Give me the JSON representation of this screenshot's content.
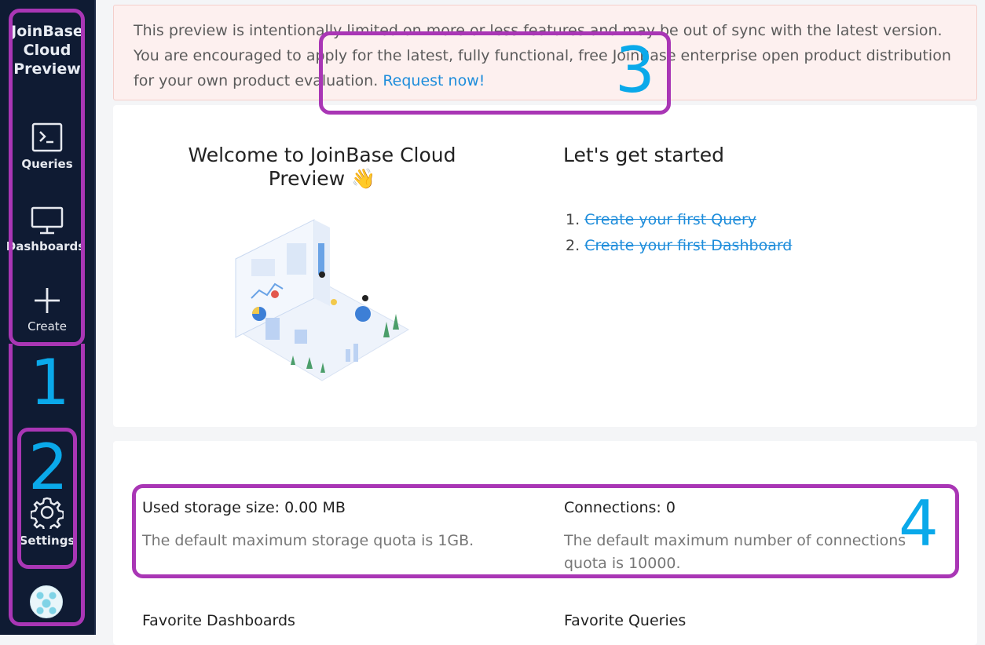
{
  "sidebar": {
    "logo_lines": [
      "JoinBase",
      "Cloud",
      "Preview"
    ],
    "items": [
      {
        "label": "Queries",
        "icon": "terminal-icon"
      },
      {
        "label": "Dashboards",
        "icon": "monitor-icon"
      },
      {
        "label": "Create",
        "icon": "plus-icon"
      },
      {
        "label": "Settings",
        "icon": "gear-icon"
      }
    ],
    "avatar": "user-avatar"
  },
  "alert": {
    "text": "This preview is intentionally limited on more or less features and may be out of sync with the latest version. You are encouraged to apply for the latest, fully functional, free JoinBase enterprise open product distribution for your own product evaluation. ",
    "link": "Request now!"
  },
  "welcome": {
    "title": "Welcome to JoinBase Cloud Preview 👋",
    "started_title": "Let's get started",
    "steps": [
      {
        "num": "1.",
        "label": "Create your first Query"
      },
      {
        "num": "2.",
        "label": "Create your first Dashboard"
      }
    ]
  },
  "stats": {
    "storage_label": "Used storage size: 0.00 MB",
    "storage_note": "The default maximum storage quota is 1GB.",
    "connections_label": "Connections: 0",
    "connections_note": "The default maximum number of connections quota is 10000.",
    "favorite_dashboards": "Favorite Dashboards",
    "favorite_queries": "Favorite Queries"
  },
  "annotations": [
    "1",
    "2",
    "3",
    "4"
  ],
  "colors": {
    "sidebar_bg": "#0f1b33",
    "annotation_box": "#a936b5",
    "annotation_number": "#0aa9ea",
    "link": "#1e8ddb",
    "alert_bg": "#fdf0ef"
  }
}
